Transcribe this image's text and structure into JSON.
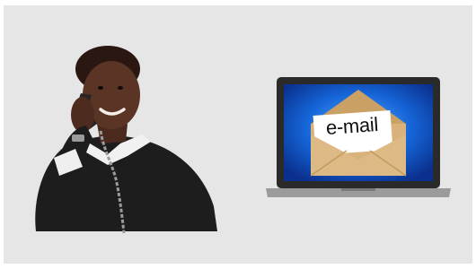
{
  "illustration": {
    "envelope_letter_text": "e-mail",
    "icons": {
      "left": "person-on-telephone",
      "right": "laptop-email-envelope"
    },
    "colors": {
      "background": "#e6e6e6",
      "laptop_screen": "#1565d8",
      "envelope": "#d8b27a",
      "clothing": "#1d1d1d"
    }
  }
}
